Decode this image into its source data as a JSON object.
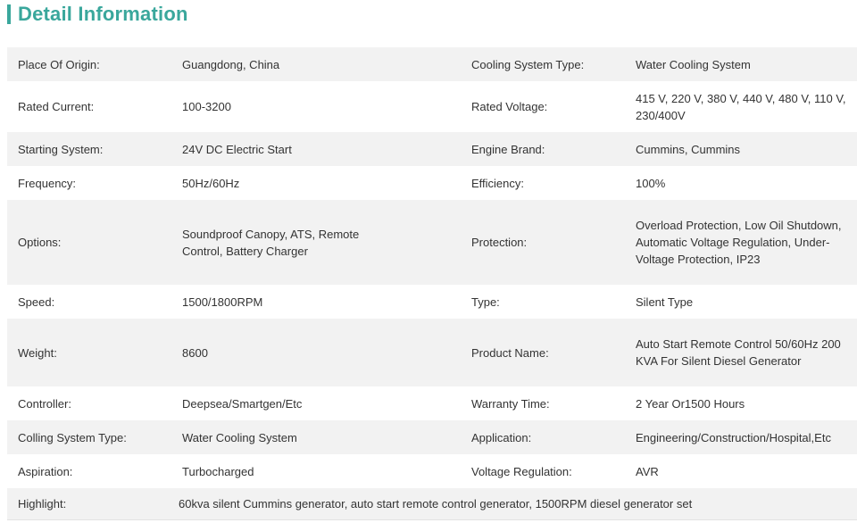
{
  "header": {
    "title": "Detail Information",
    "accent_color": "#3aa79c"
  },
  "rows": [
    {
      "l1": "Place Of Origin:",
      "v1": "Guangdong, China",
      "l2": "Cooling System Type:",
      "v2": "Water Cooling System"
    },
    {
      "l1": "Rated Current:",
      "v1": "100-3200",
      "l2": "Rated Voltage:",
      "v2": "415 V, 220 V, 380 V, 440 V, 480 V, 110 V, 230/400V"
    },
    {
      "l1": "Starting System:",
      "v1": "24V DC Electric Start",
      "l2": "Engine Brand:",
      "v2": "Cummins, Cummins"
    },
    {
      "l1": "Frequency:",
      "v1": "50Hz/60Hz",
      "l2": "Efficiency:",
      "v2": "100%"
    },
    {
      "l1": "Options:",
      "v1": "Soundproof Canopy, ATS, Remote Control, Battery Charger",
      "l2": "Protection:",
      "v2": "Overload Protection, Low Oil Shutdown, Automatic Voltage Regulation, Under-Voltage Protection, IP23"
    },
    {
      "l1": "Speed:",
      "v1": "1500/1800RPM",
      "l2": "Type:",
      "v2": "Silent Type"
    },
    {
      "l1": "Weight:",
      "v1": "8600",
      "l2": "Product Name:",
      "v2": "Auto Start Remote Control 50/60Hz 200 KVA For Silent Diesel Generator"
    },
    {
      "l1": "Controller:",
      "v1": "Deepsea/Smartgen/Etc",
      "l2": "Warranty Time:",
      "v2": "2 Year Or1500 Hours"
    },
    {
      "l1": "Colling System Type:",
      "v1": "Water Cooling System",
      "l2": "Application:",
      "v2": "Engineering/Construction/Hospital,Etc"
    },
    {
      "l1": "Aspiration:",
      "v1": "Turbocharged",
      "l2": "Voltage Regulation:",
      "v2": "AVR"
    }
  ],
  "highlight": {
    "label": "Highlight:",
    "value": "60kva silent Cummins generator, auto start remote control generator, 1500RPM diesel generator set"
  }
}
